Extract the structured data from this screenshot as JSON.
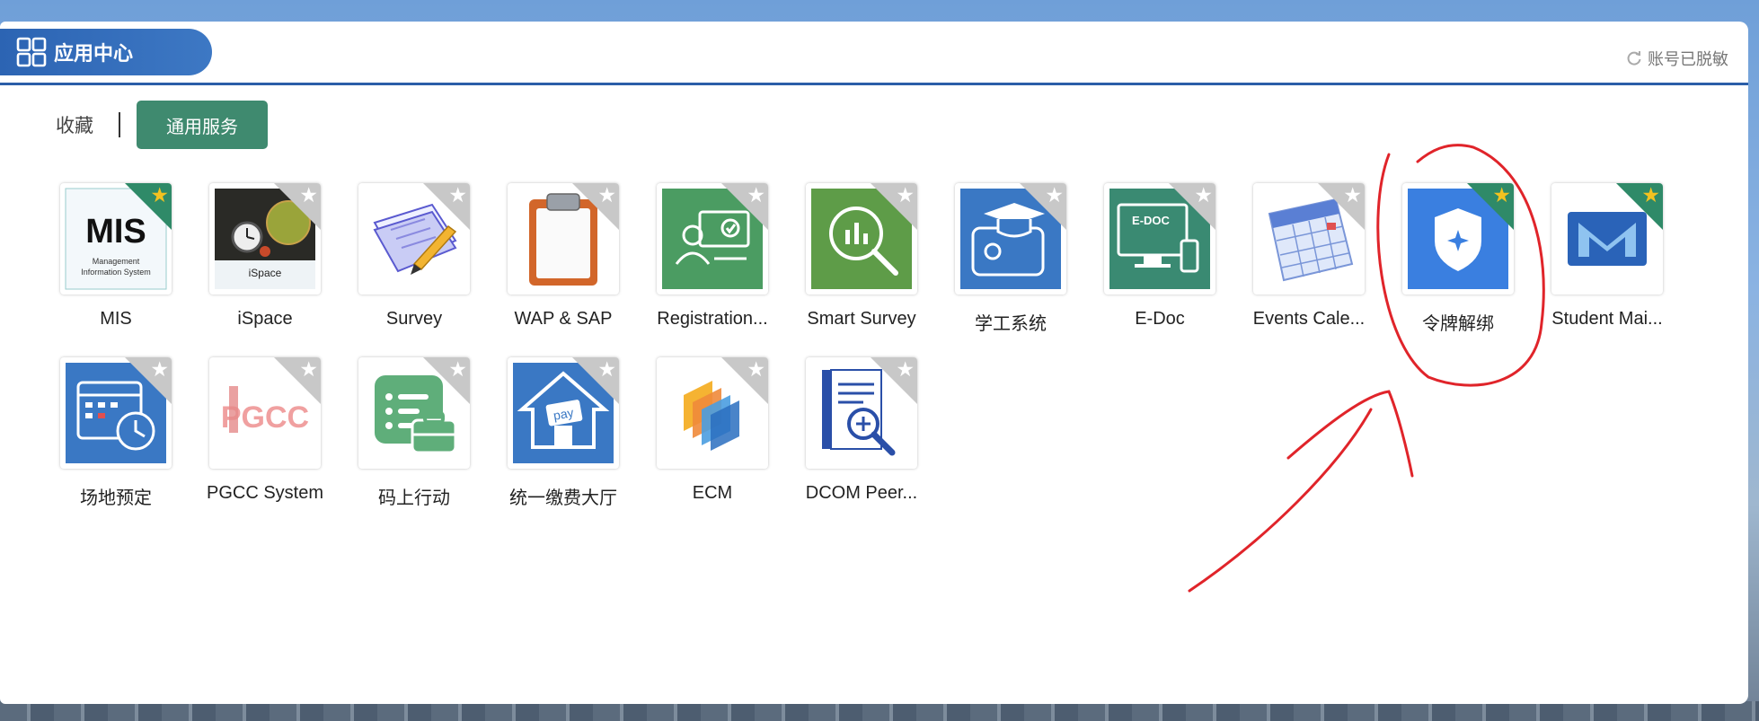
{
  "header": {
    "title": "应用中心",
    "account_status": "账号已脱敏"
  },
  "tabs": {
    "favorites": "收藏",
    "general": "通用服务"
  },
  "apps": [
    {
      "label": "MIS",
      "icon": "mis-logo-icon",
      "favorited": true,
      "mis_logo": "MIS",
      "mis_sub1": "Management",
      "mis_sub2": "Information System"
    },
    {
      "label": "iSpace",
      "icon": "ispace-clock-globe-icon",
      "favorited": false,
      "ispace_caption": "iSpace"
    },
    {
      "label": "Survey",
      "icon": "survey-pencil-icon",
      "favorited": false
    },
    {
      "label": "WAP & SAP",
      "icon": "clipboard-icon",
      "favorited": false
    },
    {
      "label": "Registration...",
      "icon": "registration-monitor-icon",
      "favorited": false
    },
    {
      "label": "Smart Survey",
      "icon": "magnifier-chart-icon",
      "favorited": false
    },
    {
      "label": "学工系统",
      "icon": "graduation-card-icon",
      "favorited": false
    },
    {
      "label": "E-Doc",
      "icon": "edoc-monitor-icon",
      "favorited": false,
      "edoc_text": "E-DOC"
    },
    {
      "label": "Events Cale...",
      "icon": "calendar-icon",
      "favorited": false
    },
    {
      "label": "令牌解绑",
      "icon": "shield-icon",
      "favorited": true
    },
    {
      "label": "Student Mai...",
      "icon": "student-mail-icon",
      "favorited": true
    },
    {
      "label": "场地预定",
      "icon": "calendar-clock-icon",
      "favorited": false
    },
    {
      "label": "PGCC System",
      "icon": "pgcc-logo-icon",
      "favorited": false,
      "pgcc_text": "PGCC"
    },
    {
      "label": "码上行动",
      "icon": "list-briefcase-icon",
      "favorited": false
    },
    {
      "label": "统一缴费大厅",
      "icon": "pay-house-icon",
      "favorited": false,
      "pay_text": "pay"
    },
    {
      "label": "ECM",
      "icon": "ecm-layers-icon",
      "favorited": false
    },
    {
      "label": "DCOM Peer...",
      "icon": "document-search-icon",
      "favorited": false
    }
  ],
  "colors": {
    "header_blue": "#2c64b3",
    "tab_green": "#3f8a6f",
    "favorite_star": "#f3c220",
    "annotation_red": "#e0242a"
  }
}
